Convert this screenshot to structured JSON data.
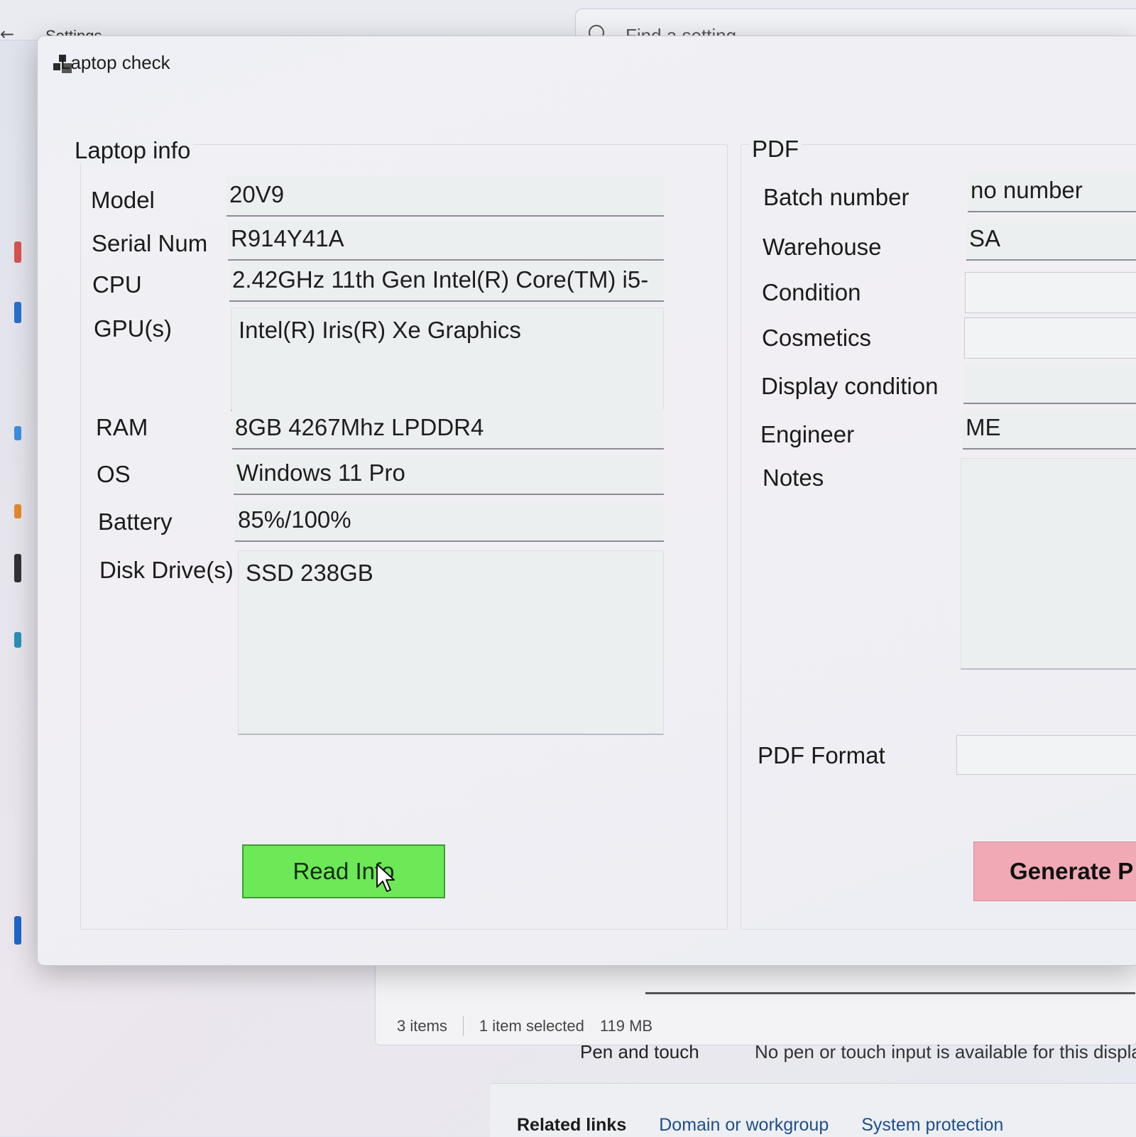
{
  "background": {
    "settings_title": "Settings",
    "search_placeholder": "Find a setting",
    "back_glyph": "←",
    "explorer": {
      "status_items": "3 items",
      "status_selected": "1 item selected",
      "status_size": "119 MB"
    },
    "pen_touch": {
      "label": "Pen and touch",
      "value": "No pen or touch input is available for this display"
    },
    "related_links": {
      "title": "Related links",
      "links": [
        "Domain or workgroup",
        "System protection"
      ]
    }
  },
  "window": {
    "title": "Laptop check"
  },
  "laptop_info": {
    "title": "Laptop info",
    "fields": [
      {
        "label": "Model",
        "value": "20V9"
      },
      {
        "label": "Serial Num",
        "value": "R914Y41A"
      },
      {
        "label": "CPU",
        "value": "2.42GHz 11th Gen Intel(R) Core(TM) i5-"
      },
      {
        "label": "GPU(s)",
        "value": "Intel(R) Iris(R) Xe Graphics"
      },
      {
        "label": "RAM",
        "value": "8GB 4267Mhz LPDDR4"
      },
      {
        "label": "OS",
        "value": "Windows 11 Pro"
      },
      {
        "label": "Battery",
        "value": "85%/100%"
      },
      {
        "label": "Disk Drive(s)",
        "value": "SSD 238GB"
      }
    ],
    "read_button": "Read Info"
  },
  "pdf": {
    "title": "PDF",
    "fields": [
      {
        "label": "Batch number",
        "value": "no number"
      },
      {
        "label": "Warehouse",
        "value": "SA"
      },
      {
        "label": "Condition",
        "value": ""
      },
      {
        "label": "Cosmetics",
        "value": ""
      },
      {
        "label": "Display condition",
        "value": ""
      },
      {
        "label": "Engineer",
        "value": "ME"
      },
      {
        "label": "Notes",
        "value": ""
      },
      {
        "label": "PDF Format",
        "value": ""
      }
    ],
    "generate_button": "Generate P"
  },
  "colors": {
    "read_button": "#6de857",
    "generate_button": "#f0a9b5"
  },
  "icons": {
    "window": "app-window-icon",
    "cursor": "mouse-pointer-icon",
    "search": "search-icon"
  }
}
